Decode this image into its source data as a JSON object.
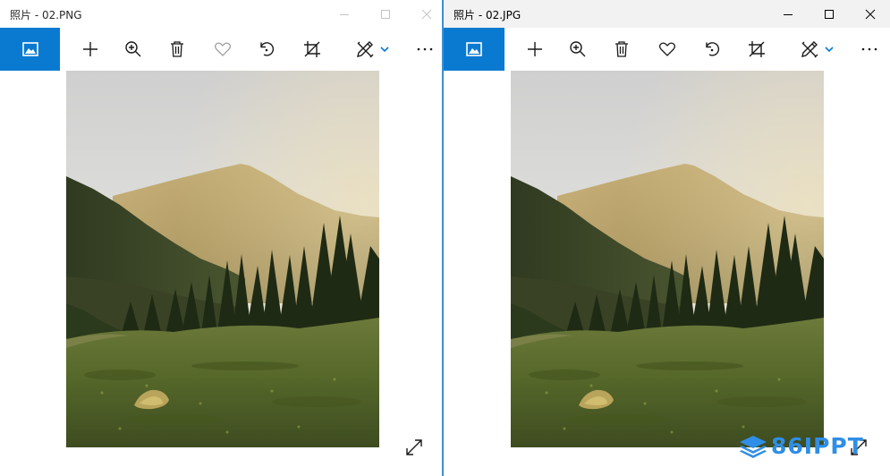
{
  "left_window": {
    "title": "照片 - 02.PNG",
    "state": "inactive",
    "toolbar_icons": [
      "photos-app-icon",
      "add-icon",
      "zoom-in-icon",
      "delete-icon",
      "favorite-icon",
      "rotate-icon",
      "crop-icon",
      "edit-create-icon",
      "chevron-down-icon",
      "more-icon"
    ],
    "image": {
      "subject": "mountain-meadow-photo"
    }
  },
  "right_window": {
    "title": "照片 - 02.JPG",
    "state": "active",
    "toolbar_icons": [
      "photos-app-icon",
      "add-icon",
      "zoom-in-icon",
      "delete-icon",
      "favorite-icon",
      "rotate-icon",
      "crop-icon",
      "edit-create-icon",
      "chevron-down-icon",
      "more-icon"
    ],
    "image": {
      "subject": "mountain-meadow-photo"
    }
  },
  "colors": {
    "accent": "#0a7ad1",
    "inactive_icon": "#a0a0a0",
    "active_icon": "#1a1a1a",
    "watermark": "#2f8ee6"
  },
  "watermark": {
    "text": "86IPPT"
  }
}
